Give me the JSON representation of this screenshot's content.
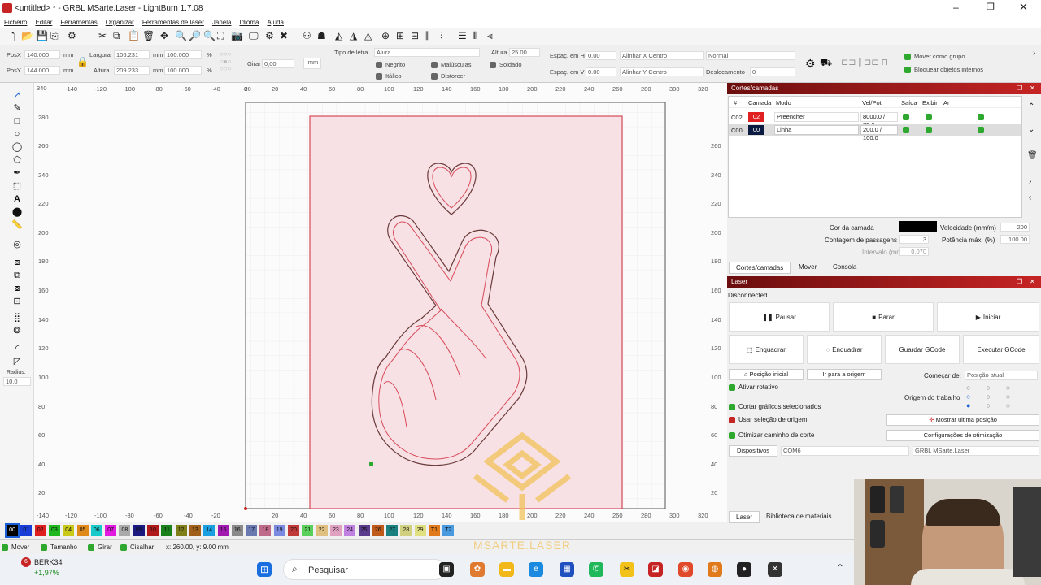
{
  "window": {
    "title": "<untitled> * - GRBL MSarte.Laser - LightBurn 1.7.08"
  },
  "menu": [
    "Ficheiro",
    "Editar",
    "Ferramentas",
    "Organizar",
    "Ferramentas de laser",
    "Janela",
    "Idioma",
    "Ajuda"
  ],
  "numbar": {
    "posx_label": "PosX",
    "posx": "140.000",
    "posy_label": "PosY",
    "posy": "144.000",
    "unit": "mm",
    "width_label": "Largura",
    "width": "106.231",
    "height_label": "Altura",
    "height": "209.233",
    "scale_w": "100.000",
    "scale_h": "100.000",
    "pct": "%",
    "rotate_label": "Girar",
    "rotate": "0,00",
    "mm_btn": "mm",
    "font_label": "Tipo de letra",
    "font": "Alura",
    "font_height_label": "Altura",
    "font_height": "25.00",
    "bold": "Negrito",
    "italic": "Itálico",
    "caps": "Maiúsculas",
    "welded": "Soldado",
    "distort": "Distorcer",
    "hspace_label": "Espaç. em H",
    "hspace": "0.00",
    "vspace_label": "Espaç. em V",
    "vspace": "0.00",
    "align_x": "Alinhar X Centro",
    "align_y": "Alinhar Y Centro",
    "normal": "Normal",
    "offset_label": "Deslocamento",
    "offset": "0",
    "move_group": "Mover como grupo",
    "lock_objects": "Bloquear objetos internos"
  },
  "left_tools": {
    "radius_label": "Radius:",
    "radius": "10.0"
  },
  "ruler": {
    "top": [
      "-140",
      "-120",
      "-100",
      "-80",
      "-60",
      "-40",
      "-20",
      "0",
      "20",
      "40",
      "60",
      "80",
      "100",
      "120",
      "140",
      "160",
      "180",
      "200",
      "220",
      "240",
      "260",
      "280",
      "300",
      "320"
    ],
    "left": [
      "280",
      "260",
      "240",
      "220",
      "200",
      "180",
      "160",
      "140",
      "120",
      "100",
      "80",
      "60",
      "40",
      "20"
    ],
    "corner": "340"
  },
  "layers": {
    "title": "Cortes/camadas",
    "headers": [
      "#",
      "Camada",
      "Modo",
      "Vel/Pot",
      "Saída",
      "Exibir",
      "Ar"
    ],
    "rows": [
      {
        "num": "C02",
        "layer": "02",
        "color": "#e02020",
        "mode": "Preencher",
        "speed": "8000.0 / 75.0"
      },
      {
        "num": "C00",
        "layer": "00",
        "color": "#0a1a40",
        "mode": "Linha",
        "speed": "200.0 / 100.0"
      }
    ],
    "layer_color_label": "Cor da camada",
    "speed_label": "Velocidade (mm/m)",
    "speed": "200",
    "passes_label": "Contagem de passagens",
    "passes": "3",
    "power_label": "Potência máx. (%)",
    "power": "100.00",
    "interval_label": "Intervalo (mm)",
    "interval": "0.070",
    "tabs": [
      "Cortes/camadas",
      "Mover",
      "Consola"
    ]
  },
  "laser": {
    "title": "Laser",
    "status": "Disconnected",
    "pause": "Pausar",
    "stop": "Parar",
    "start": "Iniciar",
    "frame1": "Enquadrar",
    "frame2": "Enquadrar",
    "save_gcode": "Guardar GCode",
    "run_gcode": "Executar GCode",
    "home": "Posição inicial",
    "goto_origin": "Ir para a origem",
    "start_from_label": "Começar de:",
    "start_from": "Posição atual",
    "rotary": "Ativar rotativo",
    "origin_label": "Origem do trabalho",
    "cut_selected": "Cortar gráficos selecionados",
    "use_origin": "Usar seleção de origem",
    "optimize": "Otimizar caminho de corte",
    "show_last": "Mostrar última posição",
    "opt_settings": "Configurações de otimização",
    "devices": "Dispositivos",
    "port": "COM6",
    "device": "GRBL MSarte.Laser",
    "tabs": [
      "Laser",
      "Biblioteca de materiais"
    ]
  },
  "palette": [
    {
      "l": "00",
      "c": "#000000"
    },
    {
      "l": "01",
      "c": "#1a3cd6"
    },
    {
      "l": "02",
      "c": "#e02020"
    },
    {
      "l": "03",
      "c": "#1fb81f"
    },
    {
      "l": "04",
      "c": "#c9c91a"
    },
    {
      "l": "05",
      "c": "#e08a1a"
    },
    {
      "l": "06",
      "c": "#1ac9c9"
    },
    {
      "l": "07",
      "c": "#e01ae0"
    },
    {
      "l": "08",
      "c": "#aaaaaa"
    },
    {
      "l": "09",
      "c": "#1a1a80"
    },
    {
      "l": "10",
      "c": "#b01a1a"
    },
    {
      "l": "11",
      "c": "#1a801a"
    },
    {
      "l": "12",
      "c": "#80801a"
    },
    {
      "l": "13",
      "c": "#a0601a"
    },
    {
      "l": "14",
      "c": "#1aa0e0"
    },
    {
      "l": "15",
      "c": "#a01ab0"
    },
    {
      "l": "16",
      "c": "#8a8a8a"
    },
    {
      "l": "17",
      "c": "#6a7ab0"
    },
    {
      "l": "18",
      "c": "#c06a8a"
    },
    {
      "l": "19",
      "c": "#7a8ae0"
    },
    {
      "l": "20",
      "c": "#c03a3a"
    },
    {
      "l": "21",
      "c": "#5ad05a"
    },
    {
      "l": "22",
      "c": "#e0c080"
    },
    {
      "l": "23",
      "c": "#e0a0c0"
    },
    {
      "l": "24",
      "c": "#c080e0"
    },
    {
      "l": "25",
      "c": "#5a3a8a"
    },
    {
      "l": "26",
      "c": "#c05a1a"
    },
    {
      "l": "27",
      "c": "#1a8080"
    },
    {
      "l": "28",
      "c": "#d0d080"
    },
    {
      "l": "29",
      "c": "#e0e080"
    },
    {
      "l": "T1",
      "c": "#e07a1a"
    },
    {
      "l": "T2",
      "c": "#4a9ae0"
    }
  ],
  "status": {
    "move": "Mover",
    "size": "Tamanho",
    "rotate": "Girar",
    "skew": "Cisalhar",
    "coords": "x: 260.00, y: 9.00 mm"
  },
  "taskbar": {
    "stock": "BERK34",
    "stock_change": "+1,97%",
    "stock_badge": "6",
    "search": "Pesquisar"
  },
  "watermark": "MSARTE.LASER"
}
